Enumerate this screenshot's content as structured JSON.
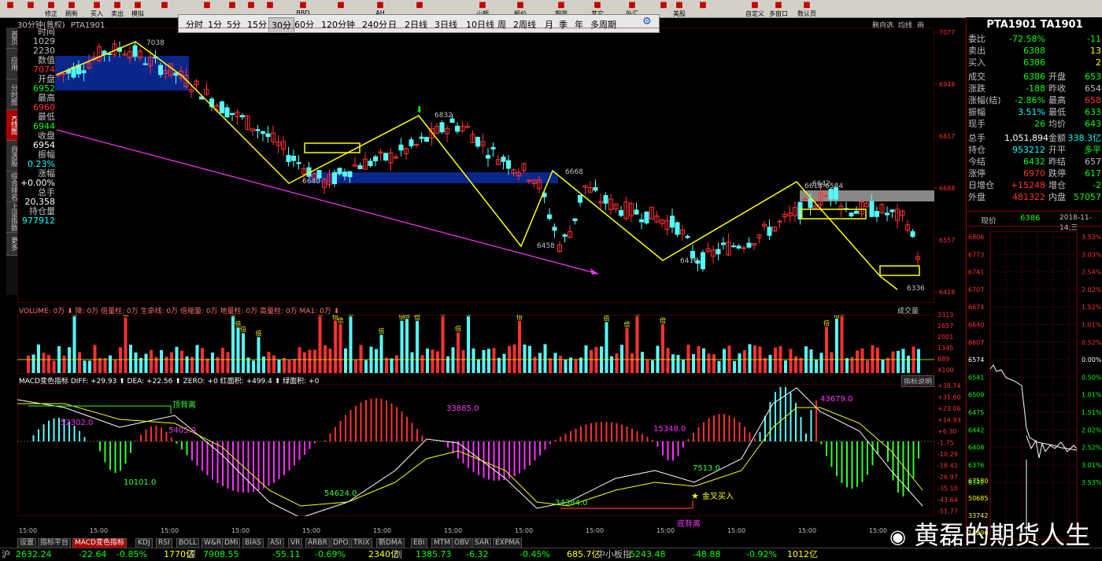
{
  "toolbar": {
    "buttons": [
      {
        "label": "",
        "icon": "grid-icon"
      },
      {
        "label": "",
        "icon": "arrow-up-icon"
      },
      {
        "label": "修正",
        "icon": "edit-icon"
      },
      {
        "label": "刷新",
        "icon": "refresh-icon"
      },
      {
        "label": "买入",
        "icon": "buy-icon"
      },
      {
        "label": "卖出",
        "icon": "sell-icon"
      },
      {
        "label": "模拟",
        "icon": "sim-icon"
      },
      {
        "label": "",
        "icon": "window-icon"
      },
      {
        "label": "",
        "icon": "chart-icon"
      },
      {
        "label": "",
        "icon": "tool-icon"
      },
      {
        "label": "",
        "icon": "tool-icon"
      },
      {
        "label": "",
        "icon": "tool-icon"
      },
      {
        "label": "BBD",
        "icon": "bbd-icon"
      },
      {
        "label": "",
        "icon": "tool-icon"
      },
      {
        "label": "AH",
        "icon": "ah-icon"
      },
      {
        "label": "",
        "icon": "tool-icon"
      },
      {
        "label": "小额",
        "icon": "tool-icon"
      },
      {
        "label": "报价",
        "icon": "tool-icon"
      },
      {
        "label": "期货",
        "icon": "tool-icon"
      },
      {
        "label": "其它",
        "icon": "tool-icon"
      },
      {
        "label": "外汇",
        "icon": "tool-icon"
      },
      {
        "label": "",
        "icon": "tool-icon"
      },
      {
        "label": "美股",
        "icon": "tool-icon"
      },
      {
        "label": "",
        "icon": "tool-icon"
      },
      {
        "label": "自定义",
        "icon": "custom-icon"
      },
      {
        "label": "多窗口",
        "icon": "multiwin-icon"
      },
      {
        "label": "数认页",
        "icon": "page-icon"
      }
    ]
  },
  "period_bar": {
    "items": [
      "分时",
      "1分",
      "5分",
      "15分",
      "30分",
      "60分",
      "120分钟",
      "240分",
      "日",
      "2日线",
      "3日线",
      "10日线",
      "周",
      "2周线",
      "月",
      "季",
      "年",
      "多周期"
    ],
    "selected": "30分",
    "settings_icon": "gear-icon"
  },
  "chart_header": {
    "title": "30分钟(普权)",
    "code": "PTA1901"
  },
  "chart_top_right": {
    "labels": [
      "删自选",
      "均线",
      "画"
    ]
  },
  "left_tabs": [
    {
      "label": "首页",
      "active": false
    },
    {
      "label": "应用",
      "active": false
    },
    {
      "label": "分时图",
      "active": false
    },
    {
      "label": "K线图",
      "active": true
    },
    {
      "label": "自选股",
      "active": false
    },
    {
      "label": "综合排名",
      "active": false
    },
    {
      "label": "上证指数",
      "active": false
    },
    {
      "label": "更多",
      "active": false
    }
  ],
  "info_panel": [
    {
      "label": "时间",
      "value": "1029",
      "value2": "2230",
      "color": "#c0c0c0"
    },
    {
      "label": "数值",
      "value": "7074",
      "color": "#ff3030"
    },
    {
      "label": "开盘",
      "value": "6952",
      "color": "#00ff00"
    },
    {
      "label": "最高",
      "value": "6960",
      "color": "#ff3030"
    },
    {
      "label": "最低",
      "value": "6944",
      "color": "#00ff00"
    },
    {
      "label": "收盘",
      "value": "6954",
      "color": "#ffffff"
    },
    {
      "label": "振幅",
      "value": "0.23%",
      "color": "#00ffff"
    },
    {
      "label": "涨幅",
      "value": "+0.00%",
      "color": "#ffffff"
    },
    {
      "label": "总手",
      "value": "20,358",
      "color": "#ffffff"
    },
    {
      "label": "持仓量",
      "value": "977912",
      "color": "#00ffff"
    }
  ],
  "price_axis": [
    "7077",
    "6948",
    "6817",
    "6688",
    "6557",
    "6428"
  ],
  "price_annotations": [
    "7038",
    "6832",
    "6640",
    "6668",
    "6458",
    "6416",
    "6642",
    "6618-6584",
    "6336"
  ],
  "volume_header": {
    "text": "VOLUME: 0万 ⬇ 降: 0万 倍量柱: 0万 生命线: 0万 倍缩量: 0万 地量柱: 0万 高量柱: 0万 MA1: 0万 ⬇",
    "right": "成交量"
  },
  "volume_axis": [
    "3313",
    "2657",
    "2001",
    "1345",
    "689",
    "X100"
  ],
  "volume_mark": "倍",
  "macd_header": {
    "text": "MACD变色指标 DIFF: +29.93 ⬆ DEA: +22.56 ⬆ ZERO: +0 红面积: +499.4 ⬆ 绿面积: +0",
    "right": "指标说明"
  },
  "macd_axis": [
    "+38.74",
    "+31.60",
    "+23.06",
    "+14.93",
    "+6.30",
    "-1.75",
    "-10.29",
    "-18.42",
    "-26.97",
    "-35.10",
    "-43.64",
    "-51.77"
  ],
  "macd_annotations": [
    "52302.0",
    "5405.0",
    "10101.0",
    "54624.0",
    "33885.0",
    "34384.0",
    "15348.0",
    "7513.0",
    "43679.0",
    "顶背离",
    "金叉买入",
    "底背离"
  ],
  "x_labels": [
    "15:00",
    "15:00",
    "15:00",
    "15:00",
    "15:00",
    "15:00",
    "15:00",
    "15:00",
    "15:00",
    "15:00",
    "15:00",
    "15:00",
    "15:00"
  ],
  "bottom_tabs": [
    {
      "label": "设置",
      "active": false
    },
    {
      "label": "指标平台",
      "active": false
    },
    {
      "label": "MACD变色指标",
      "active": true
    },
    {
      "label": "KDJ",
      "active": false
    },
    {
      "label": "RSI",
      "active": false
    },
    {
      "label": "BOLL",
      "active": false
    },
    {
      "label": "W&R",
      "active": false
    },
    {
      "label": "DMI",
      "active": false
    },
    {
      "label": "BIAS",
      "active": false
    },
    {
      "label": "ASI",
      "active": false
    },
    {
      "label": "VR",
      "active": false
    },
    {
      "label": "ARBR",
      "active": false
    },
    {
      "label": "DPO",
      "active": false
    },
    {
      "label": "TRIX",
      "active": false
    },
    {
      "label": "新DMA",
      "active": false
    },
    {
      "label": "EBI",
      "active": false
    },
    {
      "label": "MTM",
      "active": false
    },
    {
      "label": "OBV",
      "active": false
    },
    {
      "label": "SAR",
      "active": false
    },
    {
      "label": "EXPMA",
      "active": false
    }
  ],
  "right_panel": {
    "title": "PTA1901 TA1901",
    "rows": [
      {
        "l": "委比",
        "v": "-72.58%",
        "vc": "#00ff00",
        "l2": "",
        "v2": "-11",
        "v2c": "#00ff00"
      },
      {
        "l": "卖出",
        "v": "6388",
        "vc": "#00ff00",
        "l2": "",
        "v2": "13",
        "v2c": "#ffff00"
      },
      {
        "l": "买入",
        "v": "6386",
        "vc": "#00ff00",
        "l2": "",
        "v2": "2",
        "v2c": "#ffff00"
      },
      {
        "l": "成交",
        "v": "6386",
        "vc": "#00ff00",
        "l2": "开盘",
        "v2": "653",
        "v2c": "#00ff00"
      },
      {
        "l": "涨跌",
        "v": "-188",
        "vc": "#00ff00",
        "l2": "昨收",
        "v2": "654",
        "v2c": "#c0c0c0"
      },
      {
        "l": "涨幅(结)",
        "v": "-2.86%",
        "vc": "#00ff00",
        "l2": "最高",
        "v2": "658",
        "v2c": "#ff3030"
      },
      {
        "l": "振幅",
        "v": "3.51%",
        "vc": "#00ffff",
        "l2": "最低",
        "v2": "633",
        "v2c": "#00ff00"
      },
      {
        "l": "现手",
        "v": "26",
        "vc": "#00ff00",
        "l2": "均价",
        "v2": "643",
        "v2c": "#00ff00"
      },
      {
        "l": "总手",
        "v": "1,051,894",
        "vc": "#ffffff",
        "l2": "金额",
        "v2": "338.3亿",
        "v2c": "#00ffff"
      },
      {
        "l": "持仓",
        "v": "953212",
        "vc": "#00ffff",
        "l2": "开平",
        "v2": "多平",
        "v2c": "#00ff00"
      },
      {
        "l": "今结",
        "v": "6432",
        "vc": "#00ff00",
        "l2": "昨结",
        "v2": "657",
        "v2c": "#c0c0c0"
      },
      {
        "l": "涨停",
        "v": "6970",
        "vc": "#ff3030",
        "l2": "跌停",
        "v2": "617",
        "v2c": "#00ff00"
      },
      {
        "l": "日增仓",
        "v": "+15248",
        "vc": "#ff3030",
        "l2": "增仓",
        "v2": "-2",
        "v2c": "#00ff00"
      },
      {
        "l": "外盘",
        "v": "481322",
        "vc": "#ff3030",
        "l2": "内盘",
        "v2": "57057",
        "v2c": "#00ff00"
      }
    ],
    "price_row": {
      "label": "现价",
      "value": "6386",
      "date": "2018-11-14,三"
    },
    "mini_axis_left": [
      "6806",
      "6773",
      "6741",
      "6707",
      "6674",
      "6640",
      "6607",
      "6574",
      "6541",
      "6509",
      "6475",
      "6442",
      "6408",
      "6376",
      "6342"
    ],
    "mini_axis_right": [
      "3.53%",
      "3.03%",
      "2.54%",
      "2.02%",
      "1.52%",
      "1.01%",
      "0.52%",
      "0.00%",
      "0.50%",
      "1.01%",
      "1.51%",
      "2.02%",
      "2.52%",
      "3.01%",
      "3.53%"
    ],
    "mini_vol_axis": [
      "67580",
      "50685",
      "33742",
      "16896"
    ]
  },
  "status_bar": [
    {
      "t": "沪",
      "c": "#c0c0c0"
    },
    {
      "t": "2632.24",
      "c": "#00ff00"
    },
    {
      "t": "-22.64",
      "c": "#00ff00"
    },
    {
      "t": "-0.85%",
      "c": "#00ff00"
    },
    {
      "t": "1770亿",
      "c": "#ffff00"
    },
    {
      "t": "深",
      "c": "#c0c0c0"
    },
    {
      "t": "7908.55",
      "c": "#00ff00"
    },
    {
      "t": "-55.11",
      "c": "#00ff00"
    },
    {
      "t": "-0.69%",
      "c": "#00ff00"
    },
    {
      "t": "2340亿",
      "c": "#ffff00"
    },
    {
      "t": "创",
      "c": "#c0c0c0"
    },
    {
      "t": "1385.73",
      "c": "#00ff00"
    },
    {
      "t": "-6.32",
      "c": "#00ff00"
    },
    {
      "t": "-0.45%",
      "c": "#00ff00"
    },
    {
      "t": "685.7亿",
      "c": "#ffff00"
    },
    {
      "t": "中小板指",
      "c": "#c0c0c0"
    },
    {
      "t": "5243.48",
      "c": "#00ff00"
    },
    {
      "t": "-48.88",
      "c": "#00ff00"
    },
    {
      "t": "-0.92%",
      "c": "#00ff00"
    },
    {
      "t": "1012亿",
      "c": "#ffff00"
    }
  ],
  "watermark": "黄磊的期货人生",
  "colors": {
    "up": "#ff3030",
    "down": "#54ffff",
    "zigzag": "#ffff00",
    "trend": "#ff30ff",
    "band": "#0a2a9a"
  }
}
